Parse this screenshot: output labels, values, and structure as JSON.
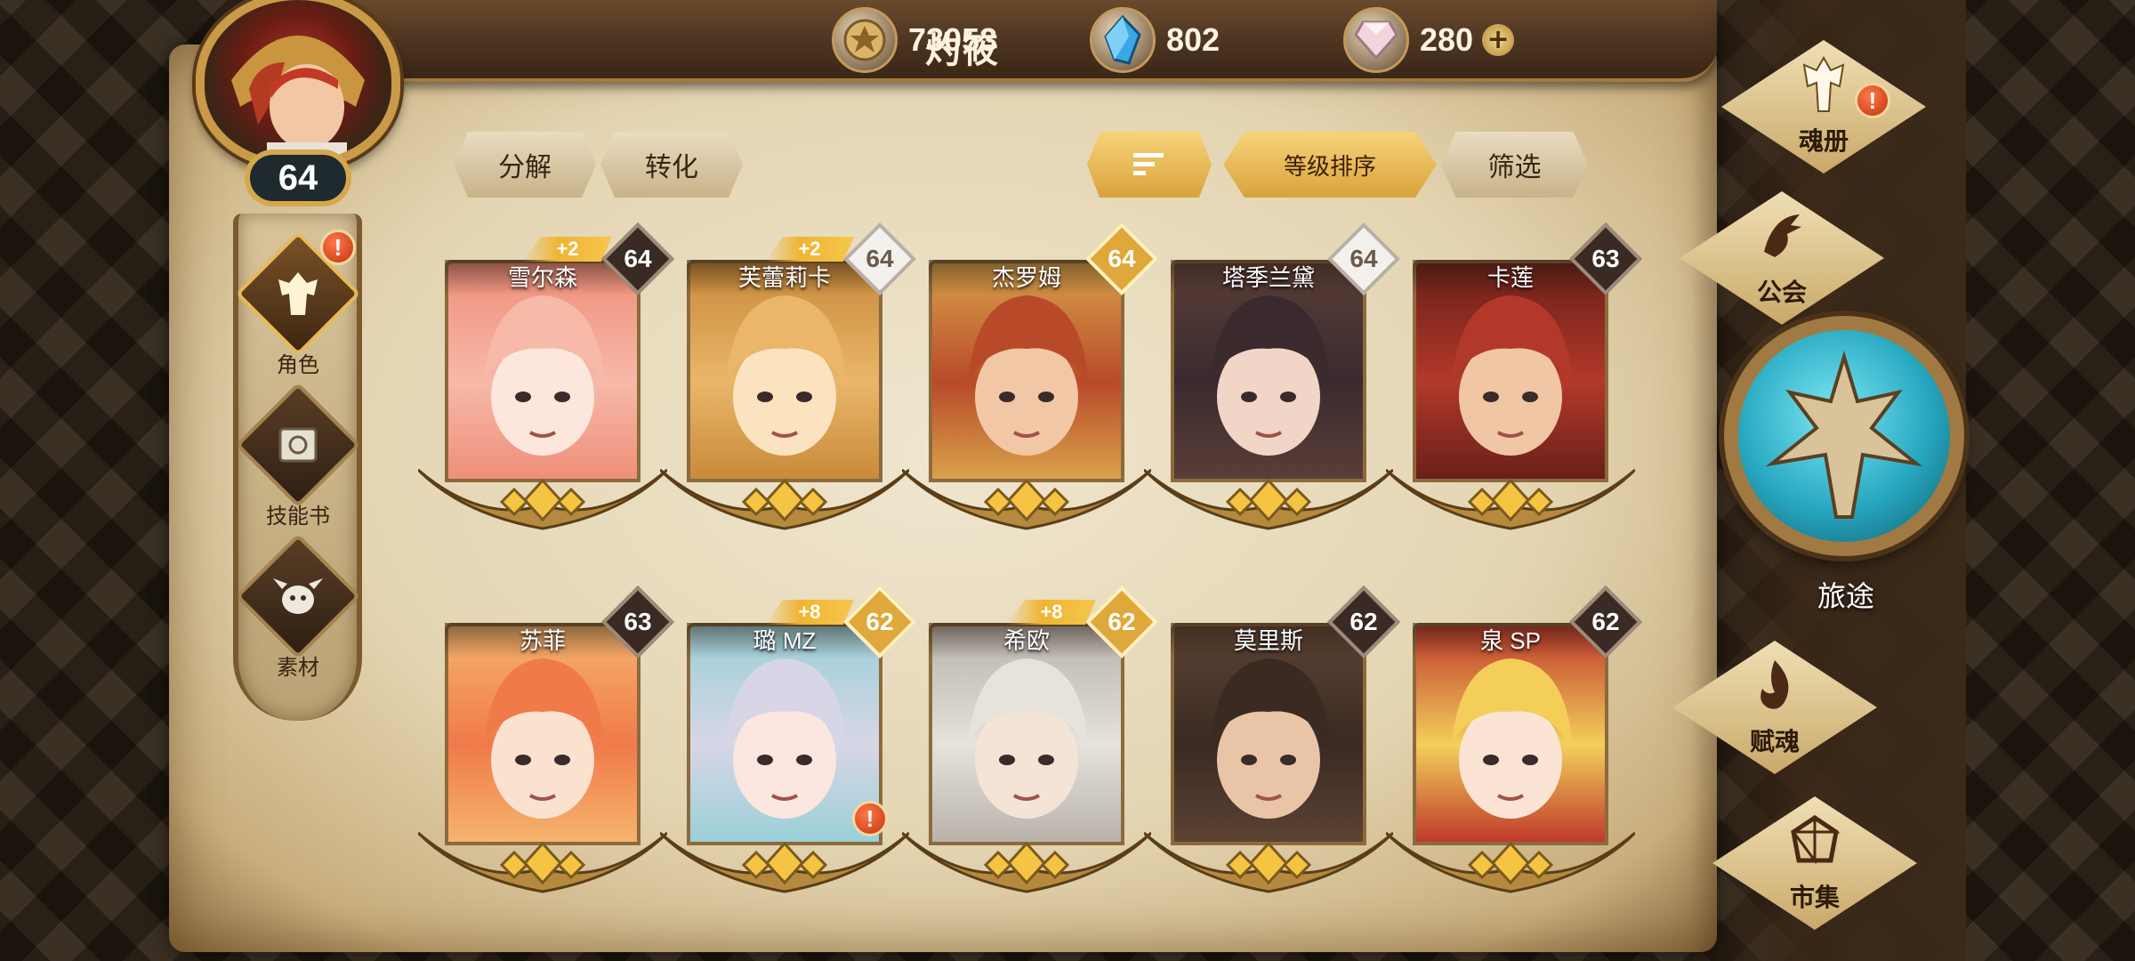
{
  "header": {
    "player_name": "灼筱",
    "gold": "73053",
    "crystals": "802",
    "gems": "280",
    "gems_add": "+"
  },
  "player": {
    "level": "64"
  },
  "sidebar": {
    "items": [
      {
        "label": "角色",
        "alert": "!"
      },
      {
        "label": "技能书"
      },
      {
        "label": "素材"
      }
    ]
  },
  "toolbar": {
    "decompose": "分解",
    "convert": "转化",
    "sort_by_level": "等级排序",
    "filter": "筛选"
  },
  "cards": [
    {
      "name": "雪尔森",
      "level": "64",
      "plus": "+2",
      "badge": "dark"
    },
    {
      "name": "芙蕾莉卡",
      "level": "64",
      "plus": "+2",
      "badge": "silver"
    },
    {
      "name": "杰罗姆",
      "level": "64",
      "plus": "",
      "badge": "gold"
    },
    {
      "name": "塔季兰黛",
      "level": "64",
      "plus": "",
      "badge": "silver"
    },
    {
      "name": "卡莲",
      "level": "63",
      "plus": "",
      "badge": "dark"
    },
    {
      "name": "苏菲",
      "level": "63",
      "plus": "",
      "badge": "dark"
    },
    {
      "name": "璐 MZ",
      "level": "62",
      "plus": "+8",
      "badge": "gold",
      "alert": "!"
    },
    {
      "name": "希欧",
      "level": "62",
      "plus": "+8",
      "badge": "gold"
    },
    {
      "name": "莫里斯",
      "level": "62",
      "plus": "",
      "badge": "dark"
    },
    {
      "name": "泉 SP",
      "level": "62",
      "plus": "",
      "badge": "dark"
    }
  ],
  "right_menu": {
    "soul_book": "魂册",
    "soul_book_alert": "!",
    "guild": "公会",
    "journey": "旅途",
    "endow_soul": "赋魂",
    "market": "市集"
  },
  "colors": {
    "accent_gold": "#e0a83a",
    "alert_red": "#c1330f",
    "journey_teal": "#27a8c0"
  }
}
